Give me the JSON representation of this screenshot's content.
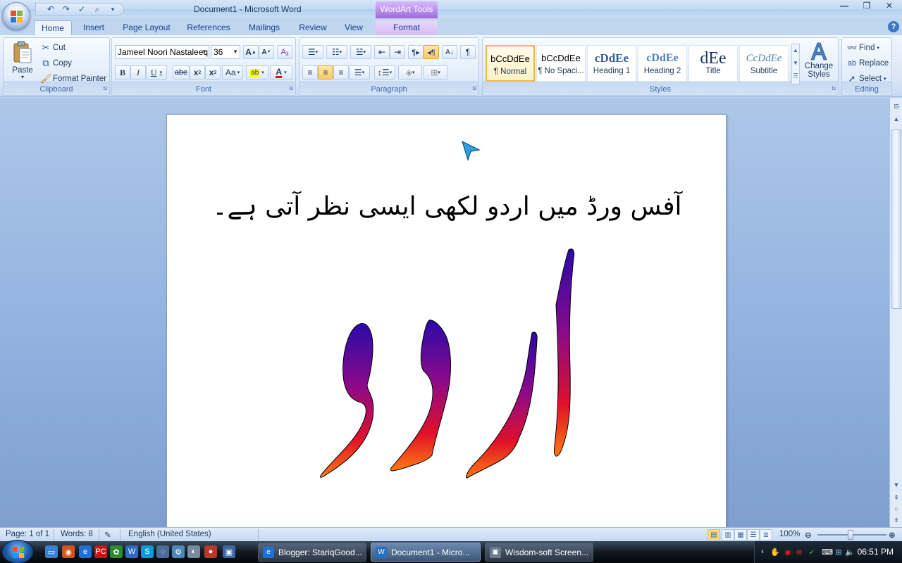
{
  "window": {
    "title": "Document1 - Microsoft Word",
    "context_tab": "WordArt Tools",
    "controls": [
      "—",
      "❐",
      "✕"
    ]
  },
  "tabs": [
    "Home",
    "Insert",
    "Page Layout",
    "References",
    "Mailings",
    "Review",
    "View",
    "Format"
  ],
  "active_tab": "Home",
  "clipboard": {
    "paste": "Paste",
    "cut": "Cut",
    "copy": "Copy",
    "format_painter": "Format Painter",
    "label": "Clipboard"
  },
  "font": {
    "name": "Jameel Noori Nastaleeq",
    "size": "36",
    "grow": "A",
    "shrink": "A",
    "bold": "B",
    "italic": "I",
    "underline": "U",
    "strike": "abe",
    "subscript": "x",
    "superscript": "x",
    "change_case": "Aa",
    "highlight": "ab",
    "font_color": "A",
    "label": "Font"
  },
  "paragraph": {
    "pilcrow": "¶",
    "label": "Paragraph"
  },
  "styles": {
    "items": [
      {
        "sample": "bCcDdEe",
        "name": "¶ Normal"
      },
      {
        "sample": "bCcDdEe",
        "name": "¶ No Spaci..."
      },
      {
        "sample": "cDdEe",
        "name": "Heading 1"
      },
      {
        "sample": "cDdEe",
        "name": "Heading 2"
      },
      {
        "sample": "dEe",
        "name": "Title"
      },
      {
        "sample": "CcDdEe",
        "name": "Subtitle"
      }
    ],
    "change_styles": "Change Styles",
    "label": "Styles"
  },
  "editing": {
    "find": "Find",
    "replace": "Replace",
    "select": "Select",
    "label": "Editing"
  },
  "document": {
    "text_line": "آفس ورڈ میں اردو لکھی ایسی نظر آتی ہے۔",
    "wordart_text": "اردو",
    "wordart_gradient": [
      "#2a0aa8",
      "#8a0a8a",
      "#e0102a",
      "#ff7a10"
    ]
  },
  "statusbar": {
    "page": "Page: 1 of 1",
    "words": "Words: 8",
    "language": "English (United States)",
    "zoom": "100%"
  },
  "taskbar": {
    "items": [
      {
        "label": "Blogger: StariqGood...",
        "icon": "ie-icon"
      },
      {
        "label": "Document1 - Micro...",
        "icon": "word-icon"
      },
      {
        "label": "Wisdom-soft Screen...",
        "icon": "screenshot-icon"
      }
    ],
    "clock": "06:51 PM"
  }
}
